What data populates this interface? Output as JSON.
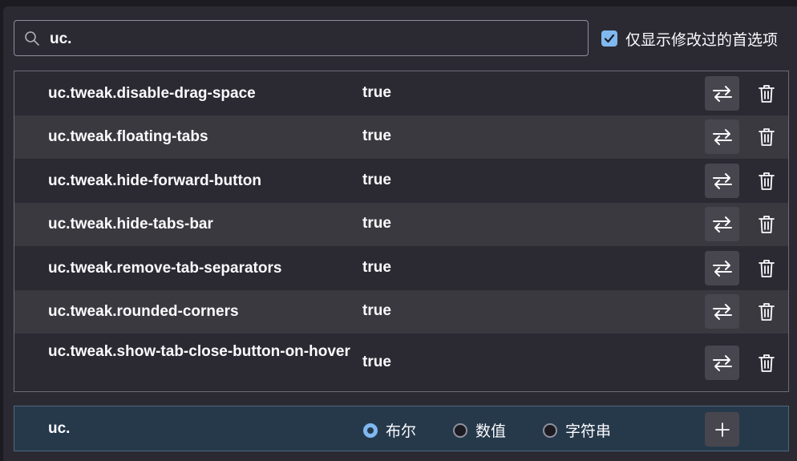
{
  "search": {
    "value": "uc."
  },
  "only_modified": {
    "label": "仅显示修改过的首选项",
    "checked": true
  },
  "prefs": [
    {
      "name": "uc.tweak.disable-drag-space",
      "value": "true"
    },
    {
      "name": "uc.tweak.floating-tabs",
      "value": "true"
    },
    {
      "name": "uc.tweak.hide-forward-button",
      "value": "true"
    },
    {
      "name": "uc.tweak.hide-tabs-bar",
      "value": "true"
    },
    {
      "name": "uc.tweak.remove-tab-separators",
      "value": "true"
    },
    {
      "name": "uc.tweak.rounded-corners",
      "value": "true"
    },
    {
      "name": "uc.tweak.show-tab-close-button-on-hover",
      "value": "true"
    }
  ],
  "add_row": {
    "name": "uc.",
    "types": [
      {
        "label": "布尔",
        "selected": true
      },
      {
        "label": "数值",
        "selected": false
      },
      {
        "label": "字符串",
        "selected": false
      }
    ]
  },
  "colors": {
    "panel": "#2b2a33",
    "row_alt": "#3a3940",
    "accent": "#80b8f0",
    "add_row_bg": "#26394b"
  }
}
